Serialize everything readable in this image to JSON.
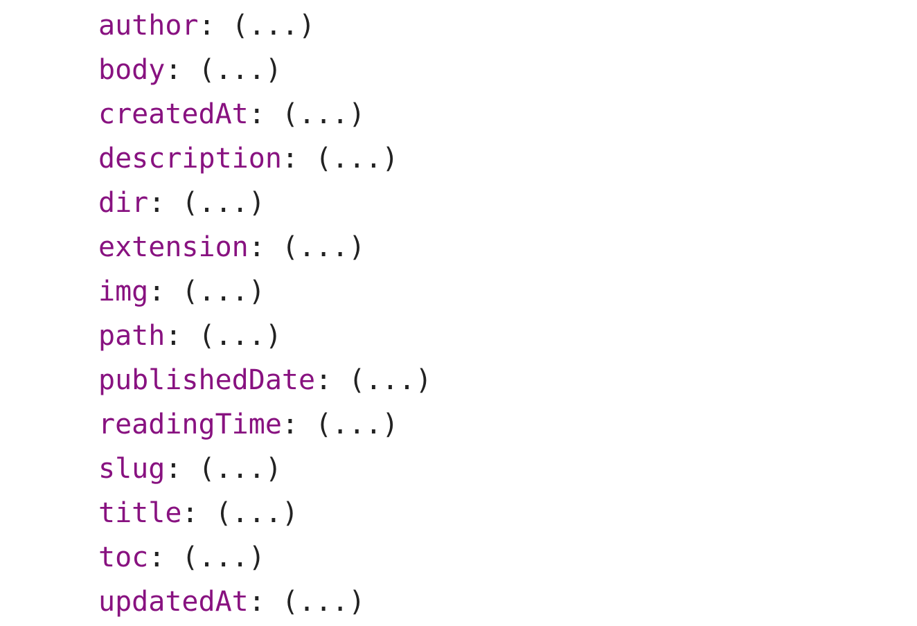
{
  "colors": {
    "key": "#881280",
    "value": "#222222",
    "background": "#ffffff"
  },
  "separator": ": ",
  "properties": [
    {
      "key": "author",
      "value": "(...)"
    },
    {
      "key": "body",
      "value": "(...)"
    },
    {
      "key": "createdAt",
      "value": "(...)"
    },
    {
      "key": "description",
      "value": "(...)"
    },
    {
      "key": "dir",
      "value": "(...)"
    },
    {
      "key": "extension",
      "value": "(...)"
    },
    {
      "key": "img",
      "value": "(...)"
    },
    {
      "key": "path",
      "value": "(...)"
    },
    {
      "key": "publishedDate",
      "value": "(...)"
    },
    {
      "key": "readingTime",
      "value": "(...)"
    },
    {
      "key": "slug",
      "value": "(...)"
    },
    {
      "key": "title",
      "value": "(...)"
    },
    {
      "key": "toc",
      "value": "(...)"
    },
    {
      "key": "updatedAt",
      "value": "(...)"
    }
  ]
}
